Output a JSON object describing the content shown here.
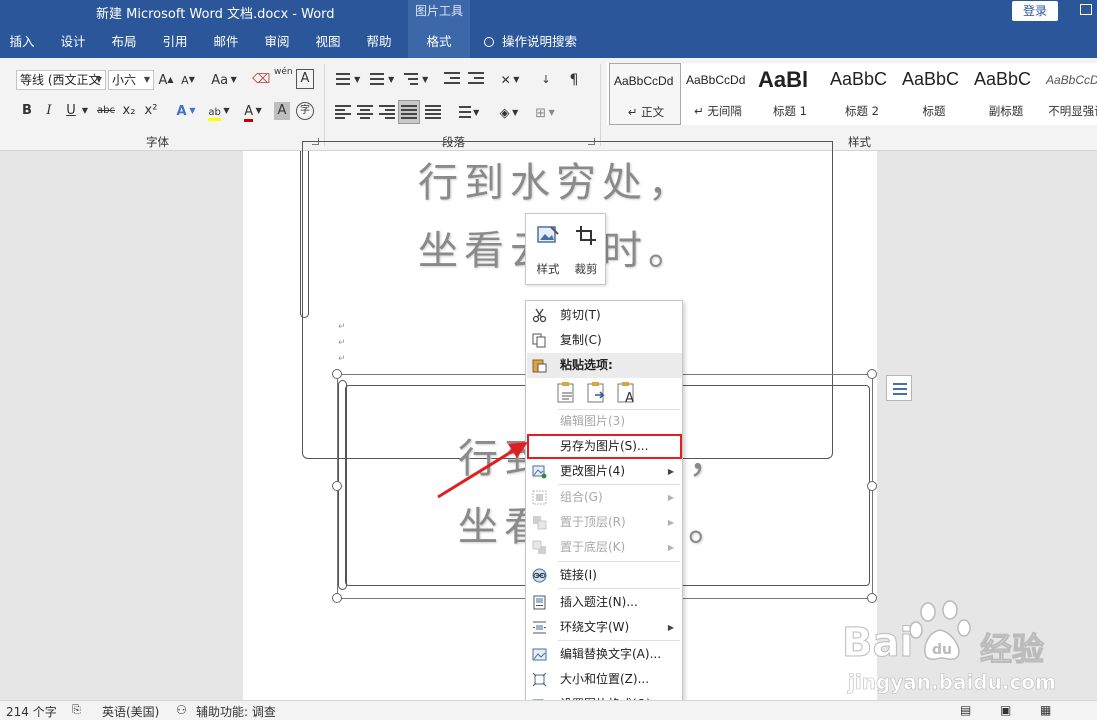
{
  "window": {
    "title": "新建 Microsoft Word 文档.docx  -  Word",
    "context_tab_group": "图片工具",
    "login_button": "登录"
  },
  "tabs": [
    {
      "label": "插入"
    },
    {
      "label": "设计"
    },
    {
      "label": "布局"
    },
    {
      "label": "引用"
    },
    {
      "label": "邮件"
    },
    {
      "label": "审阅"
    },
    {
      "label": "视图"
    },
    {
      "label": "帮助"
    },
    {
      "label": "格式",
      "active": true
    }
  ],
  "tell_me": "操作说明搜索",
  "ribbon": {
    "font": {
      "label": "字体",
      "font_name": "等线 (西文正文",
      "font_size": "小六",
      "grow": "A",
      "shrink": "A",
      "case": "Aa",
      "bold": "B",
      "italic": "I",
      "underline": "U",
      "strike": "abc",
      "subscript": "x₂",
      "superscript": "x²",
      "effects": "A",
      "font_color": "A",
      "char_shading": "A",
      "enclose": "字",
      "phonetic": "wén",
      "border": "A"
    },
    "paragraph": {
      "label": "段落"
    },
    "styles": {
      "label": "样式",
      "items": [
        {
          "sample": "AaBbCcDd",
          "name": "↵ 正文",
          "selected": true
        },
        {
          "sample": "AaBbCcDd",
          "name": "↵ 无间隔"
        },
        {
          "sample": "AaBl",
          "name": "标题 1"
        },
        {
          "sample": "AaBbC",
          "name": "标题 2"
        },
        {
          "sample": "AaBbC",
          "name": "标题"
        },
        {
          "sample": "AaBbC",
          "name": "副标题"
        },
        {
          "sample": "AaBbCcDd",
          "name": "不明显强调"
        }
      ]
    }
  },
  "document": {
    "image1_lines": [
      "行到水穷处，",
      "坐看云起时。"
    ],
    "image2_lines": [
      "行到水穷处，",
      "坐看云起时。"
    ]
  },
  "mini_toolbar": {
    "style_label": "样式",
    "crop_label": "裁剪"
  },
  "context_menu": {
    "items": [
      {
        "label": "剪切(T)",
        "icon": "scissors-icon"
      },
      {
        "label": "复制(C)",
        "icon": "copy-icon"
      },
      {
        "label": "粘贴选项:",
        "icon": "paste-icon"
      },
      {
        "label": "编辑图片(3)",
        "icon": "",
        "disabled": true
      },
      {
        "label": "另存为图片(S)...",
        "icon": "",
        "highlighted": true
      },
      {
        "label": "更改图片(4)",
        "icon": "change-picture-icon",
        "submenu": true
      },
      {
        "label": "组合(G)",
        "icon": "group-icon",
        "disabled": true,
        "submenu": true
      },
      {
        "label": "置于顶层(R)",
        "icon": "bring-front-icon",
        "disabled": true,
        "submenu": true
      },
      {
        "label": "置于底层(K)",
        "icon": "send-back-icon",
        "disabled": true,
        "submenu": true
      },
      {
        "label": "链接(I)",
        "icon": "link-icon"
      },
      {
        "label": "插入题注(N)...",
        "icon": "caption-icon"
      },
      {
        "label": "环绕文字(W)",
        "icon": "wrap-text-icon",
        "submenu": true
      },
      {
        "label": "编辑替换文字(A)...",
        "icon": "alt-text-icon"
      },
      {
        "label": "大小和位置(Z)...",
        "icon": "size-position-icon"
      },
      {
        "label": "设置图片格式(O)...",
        "icon": "format-picture-icon"
      }
    ]
  },
  "status_bar": {
    "word_count": "214 个字",
    "language": "英语(美国)",
    "accessibility": "辅助功能: 调查"
  },
  "watermark": {
    "brand": "Bai",
    "brand2": "经验",
    "url": "jingyan.baidu.com"
  },
  "colors": {
    "title_bar": "#2b579a",
    "highlight_box": "#e02020",
    "arrow": "#e02020"
  }
}
